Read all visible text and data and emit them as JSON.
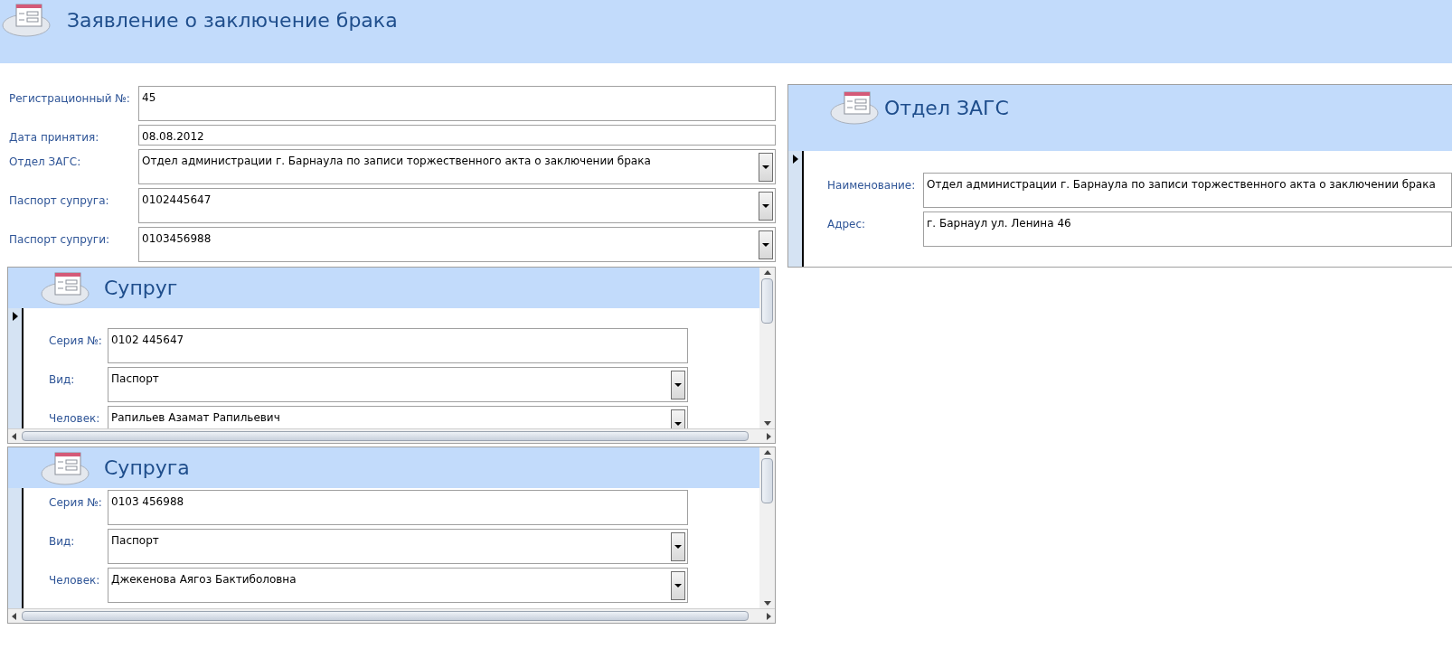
{
  "header": {
    "title": "Заявление о заключение брака"
  },
  "fields": [
    {
      "label": "Регистрационный №:",
      "value": "45",
      "kind": "text"
    },
    {
      "label": "Дата принятия:",
      "value": "08.08.2012",
      "kind": "date"
    },
    {
      "label": "Отдел ЗАГС:",
      "value": "Отдел администрации г. Барнаула по записи торжественного акта о заключении брака",
      "kind": "combo"
    },
    {
      "label": "Паспорт супруга:",
      "value": "0102445647",
      "kind": "combo"
    },
    {
      "label": "Паспорт супруги:",
      "value": "0103456988",
      "kind": "combo"
    }
  ],
  "subforms": [
    {
      "title": "Супруг",
      "current_record": true,
      "fields": [
        {
          "label": "Серия №:",
          "value": "0102 445647",
          "kind": "text"
        },
        {
          "label": "Вид:",
          "value": "Паспорт",
          "kind": "combo"
        },
        {
          "label": "Человек:",
          "value": "Рапильев Азамат Рапильевич",
          "kind": "combo"
        }
      ]
    },
    {
      "title": "Супруга",
      "current_record": false,
      "fields": [
        {
          "label": "Серия №:",
          "value": "0103 456988",
          "kind": "text"
        },
        {
          "label": "Вид:",
          "value": "Паспорт",
          "kind": "combo"
        },
        {
          "label": "Человек:",
          "value": "Джекенова Аягоз Бактиболовна",
          "kind": "combo"
        }
      ]
    }
  ],
  "zags_panel": {
    "title": "Отдел ЗАГС",
    "current_record": true,
    "fields": [
      {
        "label": "Наименование:",
        "value": "Отдел администрации г. Барнаула по записи торжественного акта о заключении брака",
        "kind": "text"
      },
      {
        "label": "Адрес:",
        "value": "г. Барнаул ул. Ленина 46",
        "kind": "text"
      }
    ]
  }
}
